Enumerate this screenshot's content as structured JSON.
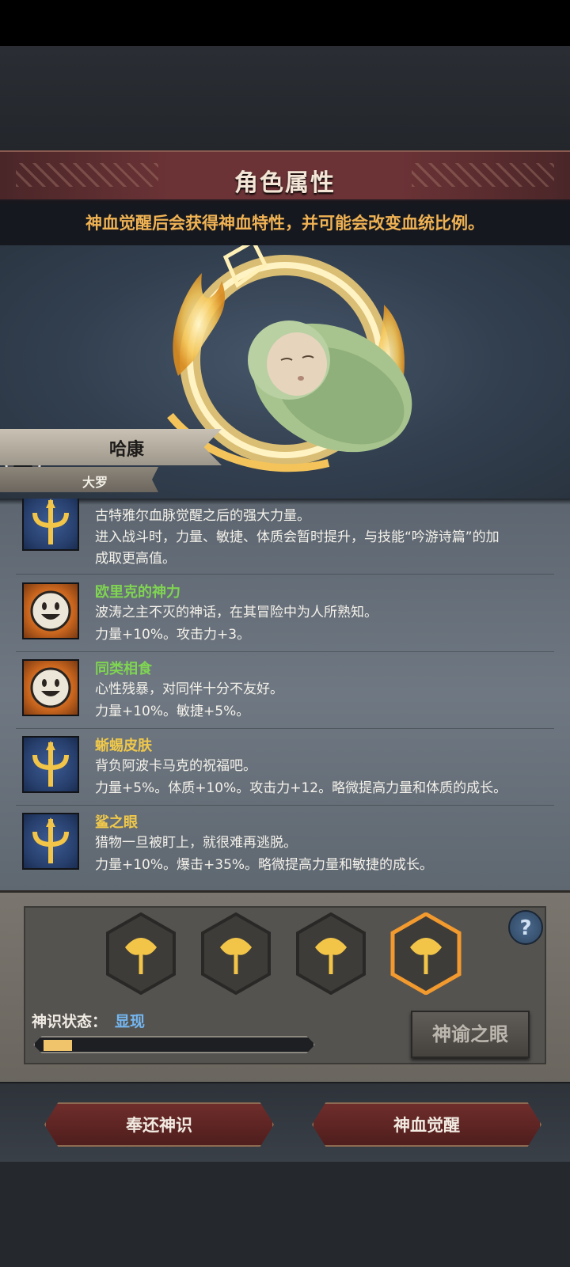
{
  "header": {
    "title": "角色属性",
    "subtitle": "神血觉醒后会获得神血特性，并可能会改变血统比例。"
  },
  "character": {
    "name": "哈康",
    "class": "大罗"
  },
  "traits": [
    {
      "name": "",
      "icon": "trident-icon",
      "lines": [
        "古特雅尔血脉觉醒之后的强大力量。",
        "进入战斗时，力量、敏捷、体质会暂时提升，与技能“吟游诗篇”的加",
        "成取更高值。"
      ]
    },
    {
      "name": "欧里克的神力",
      "name_color": "green",
      "icon": "smiley-icon",
      "lines": [
        "波涛之主不灭的神话，在其冒险中为人所熟知。",
        "力量+10%。攻击力+3。"
      ]
    },
    {
      "name": "同类相食",
      "name_color": "green",
      "icon": "smiley-icon",
      "lines": [
        "心性残暴，对同伴十分不友好。",
        "力量+10%。敏捷+5%。"
      ]
    },
    {
      "name": "蜥蜴皮肤",
      "name_color": "gold",
      "icon": "trident-icon",
      "lines": [
        "背负阿波卡马克的祝福吧。",
        "力量+5%。体质+10%。攻击力+12。略微提高力量和体质的成长。"
      ]
    },
    {
      "name": "鲨之眼",
      "name_color": "gold",
      "icon": "trident-icon",
      "lines": [
        "猎物一旦被盯上，就很难再逃脱。",
        "力量+10%。爆击+35%。略微提高力量和敏捷的成长。"
      ]
    }
  ],
  "divine": {
    "slots": 4,
    "selected_slot": 4,
    "status_label": "神识状态：",
    "status_value": "显现",
    "progress": 0.11,
    "oracle_button": "神谕之眼",
    "help_label": "?"
  },
  "actions": {
    "return_label": "奉还神识",
    "awaken_label": "神血觉醒"
  },
  "colors": {
    "title_bar": "#6b3336",
    "subtitle_text": "#f0b253",
    "trait_name_green": "#7fd452",
    "trait_name_gold": "#f0c84a",
    "status_value": "#74b6f0",
    "progress_fill": "#f0c46a"
  }
}
